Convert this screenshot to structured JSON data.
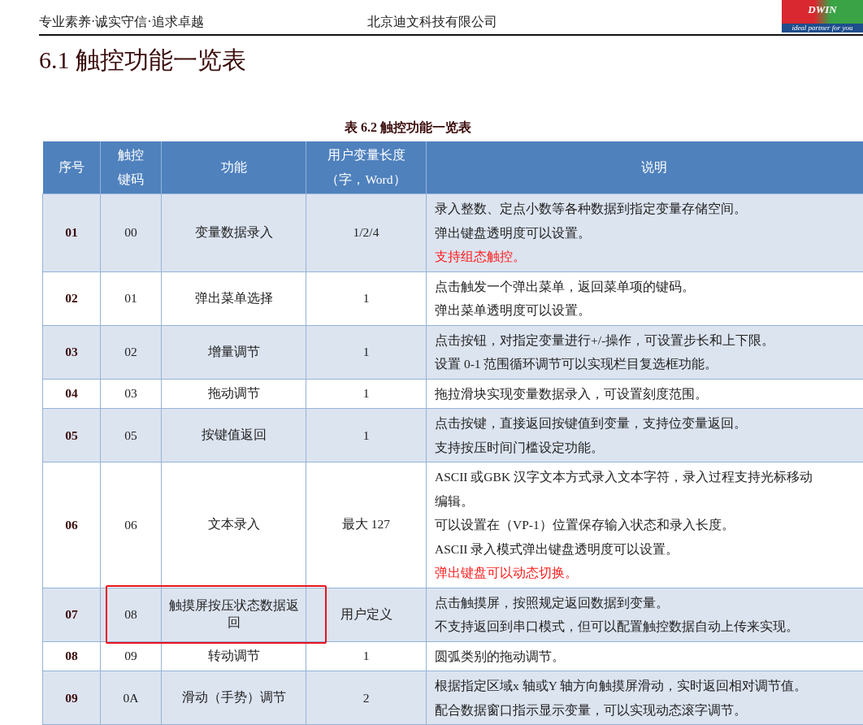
{
  "header": {
    "motto": "专业素养·诚实守信·追求卓越",
    "company": "北京迪文科技有限公司",
    "logo": {
      "name": "DWIN",
      "slogan": "ideal partner for you"
    }
  },
  "heading": "6.1 触控功能一览表",
  "table": {
    "caption": "表 6.2 触控功能一览表",
    "columns": [
      [
        "序号"
      ],
      [
        "触控",
        "键码"
      ],
      [
        "功能"
      ],
      [
        "用户变量长度",
        "（字，Word）"
      ],
      [
        "说明"
      ]
    ],
    "rows": [
      {
        "no": "01",
        "code": "00",
        "function": "变量数据录入",
        "length": "1/2/4",
        "marked": false,
        "lines": [
          {
            "text": "录入整数、定点小数等各种数据到指定变量存储空间。",
            "highlight": false
          },
          {
            "text": "弹出键盘透明度可以设置。",
            "highlight": false
          },
          {
            "text": "支持组态触控。",
            "highlight": true
          }
        ]
      },
      {
        "no": "02",
        "code": "01",
        "function": "弹出菜单选择",
        "length": "1",
        "marked": false,
        "lines": [
          {
            "text": "点击触发一个弹出菜单，返回菜单项的键码。",
            "highlight": false
          },
          {
            "text": "弹出菜单透明度可以设置。",
            "highlight": false
          }
        ]
      },
      {
        "no": "03",
        "code": "02",
        "function": "增量调节",
        "length": "1",
        "marked": false,
        "lines": [
          {
            "text": "点击按钮，对指定变量进行+/-操作，可设置步长和上下限。",
            "highlight": false
          },
          {
            "text": "设置 0-1 范围循环调节可以实现栏目复选框功能。",
            "highlight": false
          }
        ]
      },
      {
        "no": "04",
        "code": "03",
        "function": "拖动调节",
        "length": "1",
        "marked": false,
        "lines": [
          {
            "text": "拖拉滑块实现变量数据录入，可设置刻度范围。",
            "highlight": false
          }
        ]
      },
      {
        "no": "05",
        "code": "05",
        "function": "按键值返回",
        "length": "1",
        "marked": false,
        "lines": [
          {
            "text": "点击按键，直接返回按键值到变量，支持位变量返回。",
            "highlight": false
          },
          {
            "text": "支持按压时间门槛设定功能。",
            "highlight": false
          }
        ]
      },
      {
        "no": "06",
        "code": "06",
        "function": "文本录入",
        "length": "最大 127",
        "marked": false,
        "lines": [
          {
            "text": "ASCII 或GBK 汉字文本方式录入文本字符，录入过程支持光标移动",
            "highlight": false
          },
          {
            "text": "编辑。",
            "highlight": false
          },
          {
            "text": "可以设置在（VP-1）位置保存输入状态和录入长度。",
            "highlight": false
          },
          {
            "text": "ASCII 录入模式弹出键盘透明度可以设置。",
            "highlight": false
          },
          {
            "text": "弹出键盘可以动态切换。",
            "highlight": true
          }
        ]
      },
      {
        "no": "07",
        "code": "08",
        "function": "触摸屏按压状态数据返回",
        "length": "用户定义",
        "marked": true,
        "lines": [
          {
            "text": "点击触摸屏，按照规定返回数据到变量。",
            "highlight": false
          },
          {
            "text": "不支持返回到串口模式，但可以配置触控数据自动上传来实现。",
            "highlight": false
          }
        ]
      },
      {
        "no": "08",
        "code": "09",
        "function": "转动调节",
        "length": "1",
        "marked": false,
        "lines": [
          {
            "text": "圆弧类别的拖动调节。",
            "highlight": false
          }
        ]
      },
      {
        "no": "09",
        "code": "0A",
        "function": "滑动（手势）调节",
        "length": "2",
        "marked": false,
        "lines": [
          {
            "text": "根据指定区域x 轴或Y 轴方向触摸屏滑动，实时返回相对调节值。",
            "highlight": false
          },
          {
            "text": "配合数据窗口指示显示变量，可以实现动态滚字调节。",
            "highlight": false
          }
        ]
      }
    ]
  }
}
